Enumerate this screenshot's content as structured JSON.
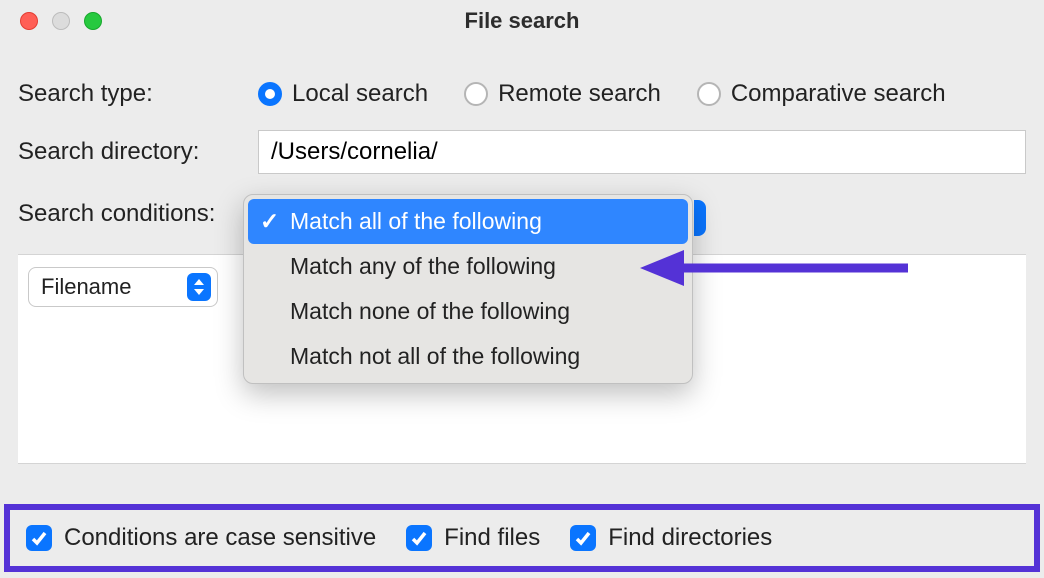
{
  "window": {
    "title": "File search"
  },
  "labels": {
    "search_type": "Search type:",
    "search_directory": "Search directory:",
    "search_conditions": "Search conditions:"
  },
  "search_type": {
    "options": {
      "local": "Local search",
      "remote": "Remote search",
      "comparative": "Comparative search"
    },
    "selected": "local"
  },
  "directory": {
    "value": "/Users/cornelia/"
  },
  "conditions_menu": {
    "items": [
      "Match all of the following",
      "Match any of the following",
      "Match none of the following",
      "Match not all of the following"
    ],
    "selected_index": 0
  },
  "rule": {
    "field": "Filename"
  },
  "checkboxes": {
    "case_sensitive": {
      "label": "Conditions are case sensitive",
      "checked": true
    },
    "find_files": {
      "label": "Find files",
      "checked": true
    },
    "find_directories": {
      "label": "Find directories",
      "checked": true
    }
  }
}
